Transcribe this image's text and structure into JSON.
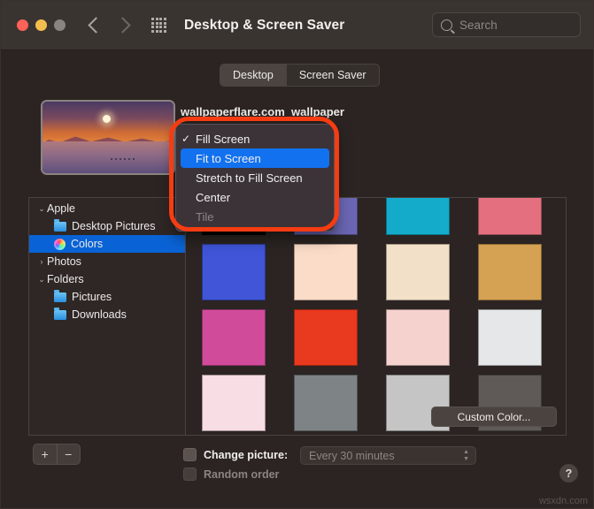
{
  "window": {
    "title": "Desktop & Screen Saver",
    "traffic_lights": [
      "close",
      "minimize",
      "zoom"
    ],
    "back_icon": "chevron-left-icon",
    "forward_icon": "chevron-right-icon",
    "grid_icon": "show-all-grid-icon"
  },
  "search": {
    "placeholder": "Search",
    "value": "",
    "icon": "search-icon"
  },
  "tabs": [
    {
      "label": "Desktop",
      "active": true
    },
    {
      "label": "Screen Saver",
      "active": false
    }
  ],
  "preview": {
    "wallpaper_name": "wallpaperflare.com_wallpaper",
    "thumbnail_alt": "sunset mountain lake wallpaper"
  },
  "scaling_menu": {
    "open": true,
    "items": [
      {
        "label": "Fill Screen",
        "checked": true,
        "selected": false,
        "disabled": false
      },
      {
        "label": "Fit to Screen",
        "checked": false,
        "selected": true,
        "disabled": false
      },
      {
        "label": "Stretch to Fill Screen",
        "checked": false,
        "selected": false,
        "disabled": false
      },
      {
        "label": "Center",
        "checked": false,
        "selected": false,
        "disabled": false
      },
      {
        "label": "Tile",
        "checked": false,
        "selected": false,
        "disabled": true
      }
    ],
    "checkmark_glyph": "✓",
    "highlight_color": "#1271ef"
  },
  "sidebar": {
    "items": [
      {
        "label": "Apple",
        "level": 0,
        "disclosure": "⌄",
        "expanded": true,
        "icon": null,
        "selected": false
      },
      {
        "label": "Desktop Pictures",
        "level": 1,
        "disclosure": "",
        "expanded": false,
        "icon": "folder-icon",
        "selected": false
      },
      {
        "label": "Colors",
        "level": 1,
        "disclosure": "",
        "expanded": false,
        "icon": "color-wheel-icon",
        "selected": true
      },
      {
        "label": "Photos",
        "level": 0,
        "disclosure": "›",
        "expanded": false,
        "icon": null,
        "selected": false
      },
      {
        "label": "Folders",
        "level": 0,
        "disclosure": "⌄",
        "expanded": true,
        "icon": null,
        "selected": false
      },
      {
        "label": "Pictures",
        "level": 1,
        "disclosure": "",
        "expanded": false,
        "icon": "folder-icon",
        "selected": false
      },
      {
        "label": "Downloads",
        "level": 1,
        "disclosure": "",
        "expanded": false,
        "icon": "folder-icon",
        "selected": false
      }
    ],
    "add_button": "+",
    "remove_button": "−"
  },
  "colors": {
    "custom_color_label": "Custom Color...",
    "swatches": [
      {
        "name": "black",
        "hex": "#000000"
      },
      {
        "name": "slate-purple",
        "hex": "#6b66b3"
      },
      {
        "name": "cyan",
        "hex": "#14abcb"
      },
      {
        "name": "salmon",
        "hex": "#e4707f"
      },
      {
        "name": "blue",
        "hex": "#4055d8"
      },
      {
        "name": "peach",
        "hex": "#fbdcc8"
      },
      {
        "name": "cream",
        "hex": "#f3e0c8"
      },
      {
        "name": "gold",
        "hex": "#d5a153"
      },
      {
        "name": "magenta",
        "hex": "#d14b9b"
      },
      {
        "name": "red-orange",
        "hex": "#e9391f"
      },
      {
        "name": "blush",
        "hex": "#f6d2cf"
      },
      {
        "name": "white-smoke",
        "hex": "#e5e7e8"
      },
      {
        "name": "light-pink",
        "hex": "#f8dde4"
      },
      {
        "name": "gray",
        "hex": "#7e8486"
      },
      {
        "name": "light-gray",
        "hex": "#c4c5c4"
      },
      {
        "name": "dark-gray",
        "hex": "#5f5a57"
      }
    ]
  },
  "bottom": {
    "change_picture_label": "Change picture:",
    "change_picture_checked": false,
    "interval_value": "Every 30 minutes",
    "random_order_label": "Random order",
    "random_order_checked": false,
    "random_order_disabled": true,
    "help_label": "?"
  },
  "watermark": "wsxdn.com"
}
